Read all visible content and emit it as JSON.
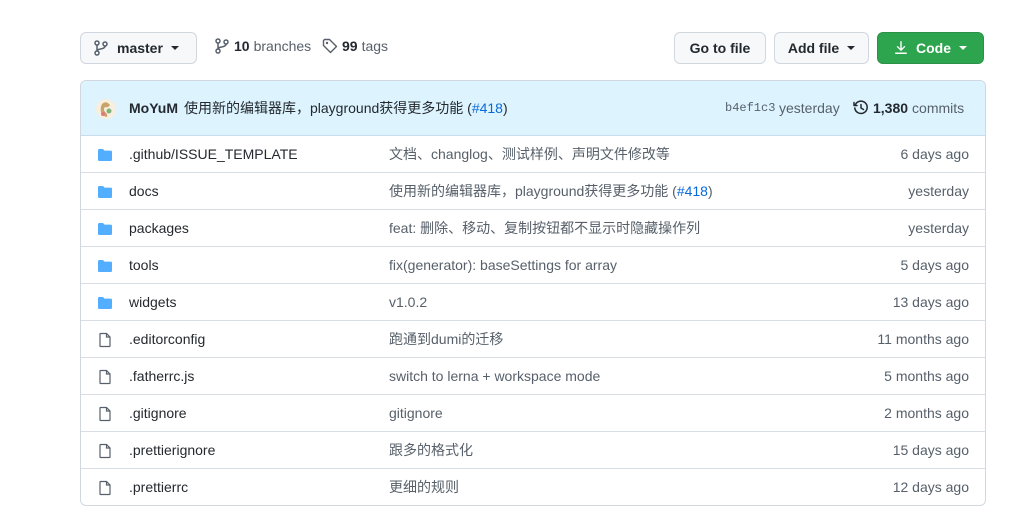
{
  "toolbar": {
    "branch": "master",
    "branches_count": "10",
    "branches_label": "branches",
    "tags_count": "99",
    "tags_label": "tags",
    "go_to_file": "Go to file",
    "add_file": "Add file",
    "code": "Code"
  },
  "latest_commit": {
    "author": "MoYuM",
    "message": "使用新的编辑器库，playground获得更多功能 (",
    "pr": "#418",
    "message_end": ")",
    "sha": "b4ef1c3",
    "time": "yesterday",
    "commit_count": "1,380",
    "commits_label": "commits"
  },
  "files": [
    {
      "type": "dir",
      "name": ".github/ISSUE_TEMPLATE",
      "message": "文档、changlog、测试样例、声明文件修改等",
      "pr": "",
      "age": "6 days ago"
    },
    {
      "type": "dir",
      "name": "docs",
      "message": "使用新的编辑器库，playground获得更多功能 (",
      "pr": "#418",
      "age": "yesterday"
    },
    {
      "type": "dir",
      "name": "packages",
      "message": "feat: 删除、移动、复制按钮都不显示时隐藏操作列",
      "pr": "",
      "age": "yesterday"
    },
    {
      "type": "dir",
      "name": "tools",
      "message": "fix(generator): baseSettings for array",
      "pr": "",
      "age": "5 days ago"
    },
    {
      "type": "dir",
      "name": "widgets",
      "message": "v1.0.2",
      "pr": "",
      "age": "13 days ago"
    },
    {
      "type": "file",
      "name": ".editorconfig",
      "message": "跑通到dumi的迁移",
      "pr": "",
      "age": "11 months ago"
    },
    {
      "type": "file",
      "name": ".fatherrc.js",
      "message": "switch to lerna + workspace mode",
      "pr": "",
      "age": "5 months ago"
    },
    {
      "type": "file",
      "name": ".gitignore",
      "message": "gitignore",
      "pr": "",
      "age": "2 months ago"
    },
    {
      "type": "file",
      "name": ".prettierignore",
      "message": "跟多的格式化",
      "pr": "",
      "age": "15 days ago"
    },
    {
      "type": "file",
      "name": ".prettierrc",
      "message": "更细的规则",
      "pr": "",
      "age": "12 days ago"
    }
  ],
  "colors": {
    "folder": "#54aeff",
    "file": "#57606a",
    "primary": "#2da44e",
    "link": "#0969da"
  }
}
